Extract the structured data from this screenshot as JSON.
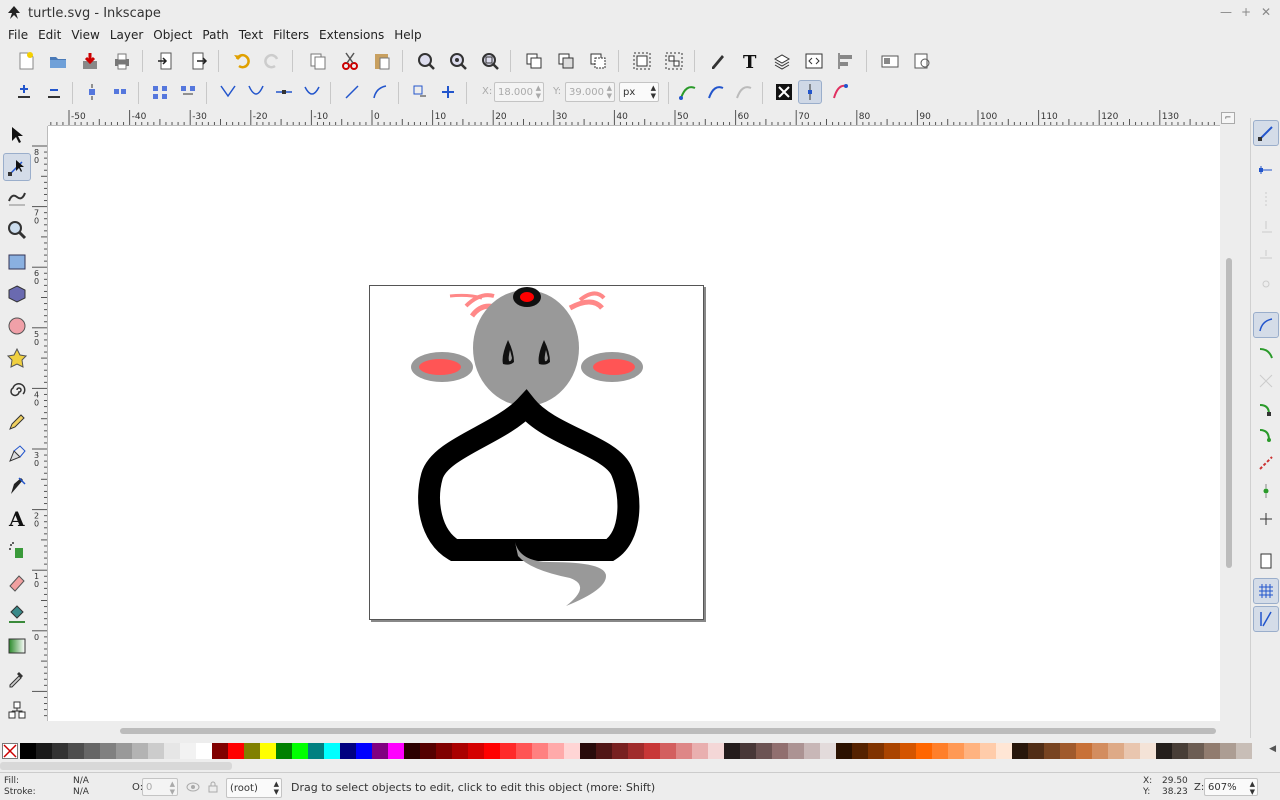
{
  "window": {
    "title": "turtle.svg - Inkscape"
  },
  "menu": [
    "File",
    "Edit",
    "View",
    "Layer",
    "Object",
    "Path",
    "Text",
    "Filters",
    "Extensions",
    "Help"
  ],
  "ctrl": {
    "x_label": "X:",
    "x_value": "18.000",
    "y_label": "Y:",
    "y_value": "39.000",
    "unit": "px"
  },
  "hruler_labels": [
    "-50",
    "-40",
    "-30",
    "-20",
    "-10",
    "0",
    "10",
    "20",
    "30",
    "40",
    "50",
    "60",
    "70",
    "80",
    "90",
    "100",
    "110",
    "120",
    "130"
  ],
  "vruler_labels": [
    "8\n0",
    "7\n0",
    "6\n0",
    "5\n0",
    "4\n0",
    "3\n0",
    "2\n0",
    "1\n0",
    "0"
  ],
  "status": {
    "fill_label": "Fill:",
    "fill_value": "N/A",
    "stroke_label": "Stroke:",
    "stroke_value": "N/A",
    "opacity_label": "O:",
    "opacity_value": "0",
    "layer": "(root)",
    "message": "Drag to select objects to edit, click to edit this object (more: Shift)",
    "x_label": "X:",
    "x_value": "29.50",
    "y_label": "Y:",
    "y_value": "38.23",
    "zoom_label": "Z:",
    "zoom_value": "607%"
  },
  "palette": [
    "#000000",
    "#1a1a1a",
    "#333333",
    "#4d4d4d",
    "#666666",
    "#808080",
    "#999999",
    "#b3b3b3",
    "#cccccc",
    "#e6e6e6",
    "#f2f2f2",
    "#ffffff",
    "#800000",
    "#ff0000",
    "#808000",
    "#ffff00",
    "#008000",
    "#00ff00",
    "#008080",
    "#00ffff",
    "#000080",
    "#0000ff",
    "#800080",
    "#ff00ff",
    "#2b0000",
    "#550000",
    "#800000",
    "#aa0000",
    "#d40000",
    "#ff0000",
    "#ff2a2a",
    "#ff5555",
    "#ff8080",
    "#ffaaaa",
    "#ffd5d5",
    "#280b0b",
    "#501616",
    "#782121",
    "#a02c2c",
    "#c83737",
    "#d35f5f",
    "#de8787",
    "#e9afaf",
    "#f4d7d7",
    "#241c1c",
    "#483737",
    "#6c5353",
    "#916f6f",
    "#ac9393",
    "#c8b7b7",
    "#e3dbdb",
    "#2b1100",
    "#552200",
    "#803300",
    "#aa4400",
    "#d45500",
    "#ff6600",
    "#ff7f2a",
    "#ff9955",
    "#ffb380",
    "#ffccaa",
    "#ffe6d5",
    "#28170b",
    "#502d16",
    "#784421",
    "#a05a2c",
    "#c87137",
    "#d38d5f",
    "#deaa87",
    "#e9c6af",
    "#f4e3d7",
    "#241f1c",
    "#483e37",
    "#6c5d53",
    "#917c6f",
    "#ac9d93",
    "#c8beb7"
  ]
}
